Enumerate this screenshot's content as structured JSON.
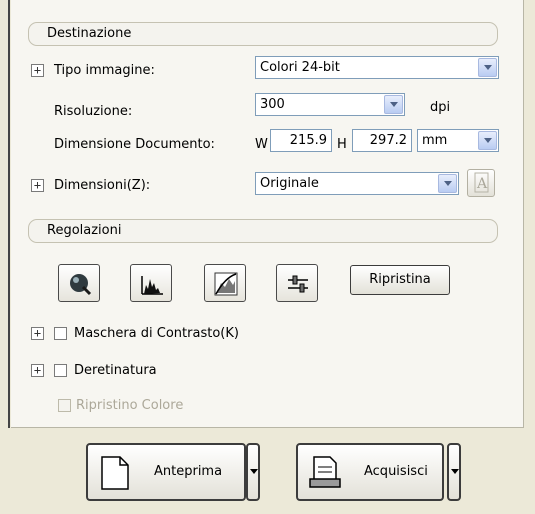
{
  "destination": {
    "header": "Destinazione",
    "image_type": {
      "label": "Tipo immagine:",
      "value": "Colori 24-bit"
    },
    "resolution": {
      "label": "Risoluzione:",
      "value": "300",
      "unit": "dpi"
    },
    "document_size": {
      "label": "Dimensione Documento:",
      "w_label": "W",
      "w_value": "215.9",
      "h_label": "H",
      "h_value": "297.2",
      "unit": "mm"
    },
    "target_size": {
      "label": "Dimensioni(Z):",
      "value": "Originale"
    }
  },
  "adjustments": {
    "header": "Regolazioni",
    "reset_label": "Ripristina",
    "unsharp_label": "Maschera di Contrasto(K)",
    "descreening_label": "Deretinatura",
    "color_restore_label": "Ripristino Colore"
  },
  "actions": {
    "preview_label": "Anteprima",
    "scan_label": "Acquisisci"
  }
}
